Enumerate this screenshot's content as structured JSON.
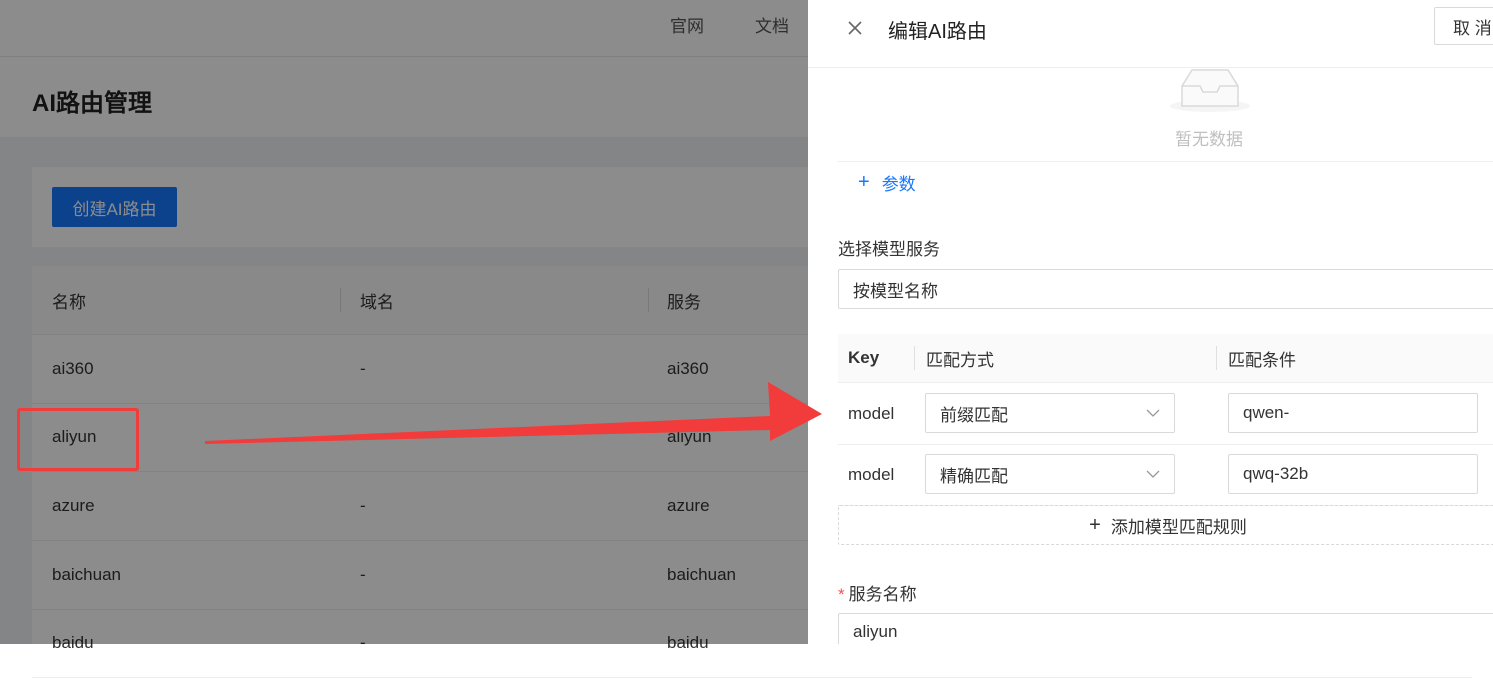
{
  "top_nav": {
    "links": [
      "官网",
      "文档"
    ]
  },
  "page": {
    "title": "AI路由管理",
    "create_button": "创建AI路由"
  },
  "table": {
    "headers": [
      "名称",
      "域名",
      "服务"
    ],
    "rows": [
      [
        "ai360",
        "-",
        "ai360"
      ],
      [
        "aliyun",
        "-",
        "aliyun"
      ],
      [
        "azure",
        "-",
        "azure"
      ],
      [
        "baichuan",
        "-",
        "baichuan"
      ],
      [
        "baidu",
        "-",
        "baidu"
      ]
    ]
  },
  "drawer": {
    "title": "编辑AI路由",
    "cancel_label": "取 消",
    "empty_text": "暂无数据",
    "add_param_label": "参数",
    "select_label": "选择模型服务",
    "select_value": "按模型名称",
    "rule_headers": [
      "Key",
      "匹配方式",
      "匹配条件"
    ],
    "rules": [
      {
        "key": "model",
        "method": "前缀匹配",
        "condition": "qwen-"
      },
      {
        "key": "model",
        "method": "精确匹配",
        "condition": "qwq-32b"
      }
    ],
    "add_rule_label": "添加模型匹配规则",
    "service_name_label": "服务名称",
    "service_name_value": "aliyun"
  },
  "colors": {
    "primary": "#1677ff",
    "annotation_red": "#f23b3b",
    "overlay": "rgba(0,0,0,0.45)"
  }
}
